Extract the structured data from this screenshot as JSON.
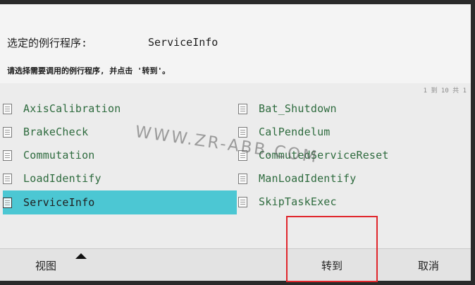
{
  "header": {
    "selected_label": "选定的例行程序:",
    "selected_value": "ServiceInfo",
    "instruction": "请选择需要调用的例行程序, 并点击 '转到'。",
    "pager": "1 到 10 共 1"
  },
  "routines": [
    {
      "name": "AxisCalibration",
      "icon": "routine-doc-icon",
      "selected": false
    },
    {
      "name": "BrakeCheck",
      "icon": "routine-doc-icon",
      "selected": false
    },
    {
      "name": "Commutation",
      "icon": "routine-doc-icon",
      "selected": false
    },
    {
      "name": "LoadIdentify",
      "icon": "routine-doc-icon",
      "selected": false
    },
    {
      "name": "ServiceInfo",
      "icon": "routine-doc-icon",
      "selected": true
    },
    {
      "name": "Bat_Shutdown",
      "icon": "routine-doc-icon",
      "selected": false
    },
    {
      "name": "CalPendelum",
      "icon": "routine-doc-icon",
      "selected": false
    },
    {
      "name": "CommutedServiceReset",
      "icon": "routine-doc-icon",
      "selected": false
    },
    {
      "name": "ManLoadIdentify",
      "icon": "routine-doc-icon",
      "selected": false
    },
    {
      "name": "SkipTaskExec",
      "icon": "routine-doc-icon",
      "selected": false
    }
  ],
  "watermark": "WWW.ZR-ABB.COM",
  "footer": {
    "view_label": "视图",
    "goto_label": "转到",
    "cancel_label": "取消"
  },
  "colors": {
    "selection": "#4cc7d3",
    "routine_text": "#2e6b3e",
    "highlight_box": "#e0262c"
  }
}
